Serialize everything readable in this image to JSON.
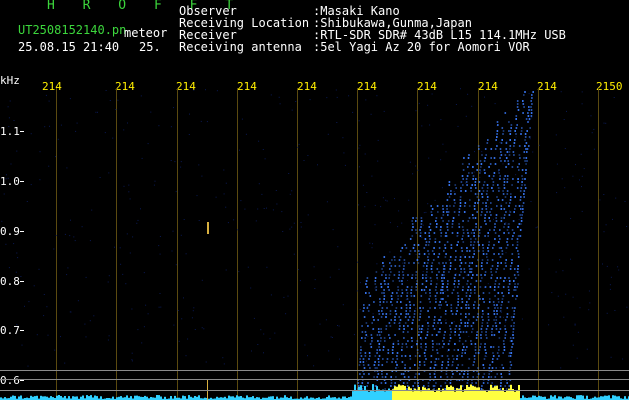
{
  "header": {
    "title": "H R O F F T",
    "filename": "UT2508152140.pn",
    "tag": "meteor",
    "datetime": "25.08.15 21:40",
    "field_value": "25.",
    "observer_label": "Observer",
    "observer_value": ":Masaki Kano",
    "location_label": "Receiving Location",
    "location_value": ":Shibukawa,Gunma,Japan",
    "receiver_label": "Receiver",
    "receiver_value": ":RTL-SDR SDR# 43dB L15 114.1MHz USB",
    "antenna_label": "Receiving antenna",
    "antenna_value": ":5el Yagi Az 20 for Aomori VOR"
  },
  "axes": {
    "y_unit": "kHz",
    "y_labels": [
      "1.1",
      "1.0",
      "0.9",
      "0.8",
      "0.7",
      "0.6"
    ],
    "x_labels": [
      "214",
      "214",
      "214",
      "214",
      "214",
      "214",
      "214",
      "214",
      "214",
      "2150"
    ]
  },
  "colors": {
    "header_green": "#3cd63c",
    "tick_yellow": "#ffee00",
    "echo_blue": "#3a7cff",
    "signal_yellow": "#ffff40",
    "noise_cyan": "#30d0ff"
  }
}
